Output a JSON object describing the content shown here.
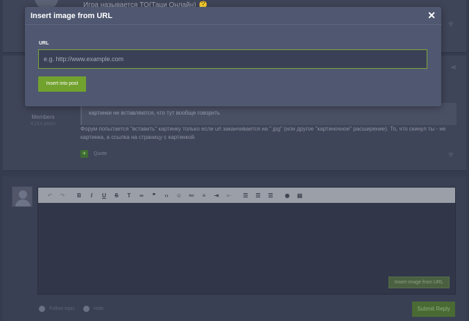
{
  "background": {
    "top_post": {
      "line": "Игра называется TO(Таци Онлайн)",
      "emoji": "🤔"
    },
    "mid_post": {
      "role": "Members",
      "post_count": "4,014 posts",
      "quote": "картинки не вставляются, что тут вообще говорить",
      "reply": "Форум попытается \"вставить\" картинку только если url заканчивается на \".jpg\" (или другое \"картиночное\" расширение). То, что скинул ты - не картинка, а ссылка на страницу с картинкой.",
      "plus": "+",
      "quote_link": "Quote"
    },
    "reply_area": {
      "insert_url_label": "Insert image from URL",
      "follow_label": "Follow topic",
      "hide_label": "Hide",
      "submit_label": "Submit Reply"
    }
  },
  "modal": {
    "title": "Insert image from URL",
    "close_glyph": "✕",
    "url_label": "URL",
    "url_placeholder": "e.g. http://www.example.com",
    "url_value": "",
    "insert_button": "Insert into post"
  },
  "icons": {
    "heart": "♥",
    "share": "⋖"
  },
  "colors": {
    "accent_green": "#72a22e",
    "input_border": "#7ea83f",
    "modal_bg": "#4f5870",
    "page_bg": "#363c4f"
  }
}
